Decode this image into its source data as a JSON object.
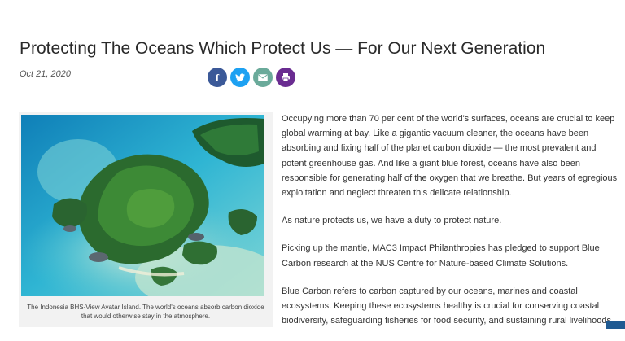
{
  "article": {
    "title": "Protecting The Oceans Which Protect Us — For Our Next Generation",
    "date": "Oct 21, 2020",
    "paragraphs": [
      "Occupying more than 70 per cent of the world's surfaces, oceans are crucial to keep global warming at bay. Like a gigantic vacuum cleaner, the oceans have been absorbing and fixing half of the planet carbon dioxide — the most prevalent and potent greenhouse gas. And like a giant blue forest, oceans have also been responsible for generating half of the oxygen that we breathe. But years of egregious exploitation and neglect threaten this delicate relationship.",
      "As nature protects us, we have a duty to protect nature.",
      "Picking up the mantle, MAC3 Impact Philanthropies has pledged to support Blue Carbon research at the NUS Centre for Nature-based Climate Solutions.",
      "Blue Carbon refers to carbon captured by our oceans, marines and coastal ecosystems. Keeping these ecosystems healthy is crucial for conserving coastal biodiversity, safeguarding fisheries for food security, and sustaining rural livelihoods."
    ]
  },
  "share": [
    {
      "icon": "facebook-icon",
      "color": "#3b5998"
    },
    {
      "icon": "twitter-icon",
      "color": "#1da1f2"
    },
    {
      "icon": "email-icon",
      "color": "#6aaa9a"
    },
    {
      "icon": "print-icon",
      "color": "#6a2c91"
    }
  ],
  "figure": {
    "caption": "The Indonesia BHS-View Avatar Island. The world's oceans absorb carbon dioxide that would otherwise stay in the atmosphere."
  },
  "colors": {
    "title": "#2a2a2a",
    "body_text": "#333333",
    "corner_accent": "#1f5a92"
  }
}
